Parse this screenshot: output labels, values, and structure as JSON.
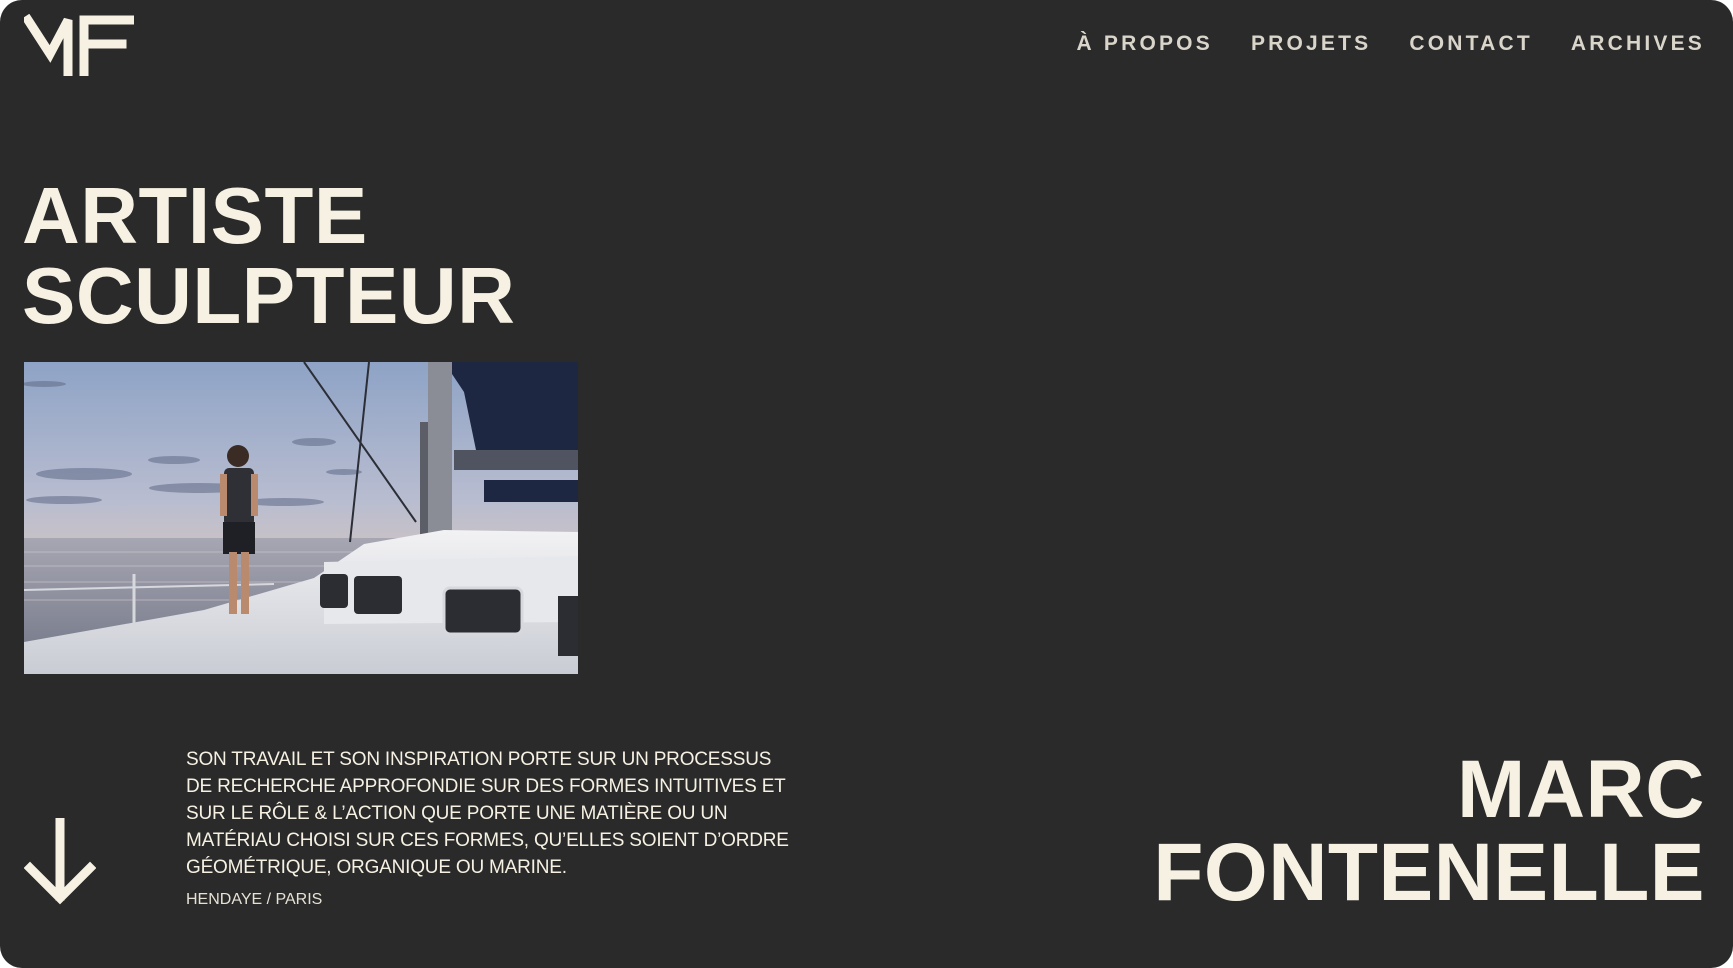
{
  "brand": {
    "logo_text": "MF"
  },
  "nav": {
    "items": [
      {
        "label": "À PROPOS"
      },
      {
        "label": "PROJETS"
      },
      {
        "label": "CONTACT"
      },
      {
        "label": "ARCHIVES"
      }
    ]
  },
  "hero": {
    "title_line1": "ARTISTE",
    "title_line2": "SCULPTEUR"
  },
  "about": {
    "description": "SON TRAVAIL ET SON INSPIRATION PORTE SUR UN PROCESSUS DE RECHERCHE APPROFONDIE SUR DES FORMES INTUITIVES ET SUR LE RÔLE & L’ACTION QUE PORTE UNE MATIÈRE OU UN MATÉRIAU CHOISI SUR CES FORMES, QU’ELLES SOIENT D’ORDRE GÉOMÉTRIQUE, ORGANIQUE OU MARINE.",
    "location": "HENDAYE / PARIS"
  },
  "artist": {
    "first_name": "MARC",
    "last_name": "FONTENELLE"
  },
  "icons": {
    "scroll": "arrow-down-icon"
  },
  "colors": {
    "background": "#2a2a2a",
    "text": "#f6f1e3",
    "nav_text": "#d9d5ca"
  }
}
